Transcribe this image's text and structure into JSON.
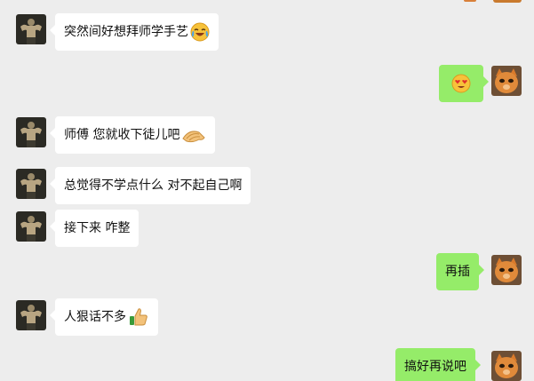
{
  "chat": {
    "messages": [
      {
        "side": "left",
        "text": "突然间好想拜师学手艺",
        "emoji": "laughing-crying-emoji"
      },
      {
        "side": "right",
        "text": "",
        "emoji": "heart-eyes-emoji"
      },
      {
        "side": "left",
        "text": "师傅 您就收下徒儿吧",
        "emoji": "bowing-hands-emoji"
      },
      {
        "side": "left",
        "text": "总觉得不学点什么 对不起自己啊",
        "emoji": ""
      },
      {
        "side": "left",
        "text": "接下来 咋整",
        "emoji": ""
      },
      {
        "side": "right",
        "text": "再插",
        "emoji": ""
      },
      {
        "side": "left",
        "text": "人狠话不多",
        "emoji": "thumbs-up-emoji"
      },
      {
        "side": "right",
        "text": "搞好再说吧",
        "emoji": ""
      }
    ]
  },
  "colors": {
    "background": "#ededed",
    "incoming_bubble": "#ffffff",
    "outgoing_bubble": "#95ec69"
  }
}
